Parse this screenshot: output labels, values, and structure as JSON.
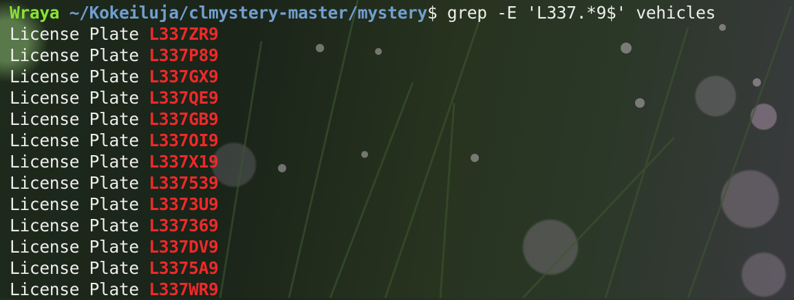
{
  "prompt": {
    "user": "Wraya",
    "path": "~/Kokeiluja/clmystery-master/mystery",
    "symbol": "$",
    "command": " grep -E 'L337.*9$' vehicles"
  },
  "output": [
    {
      "prefix": "License Plate ",
      "match": "L337ZR9"
    },
    {
      "prefix": "License Plate ",
      "match": "L337P89"
    },
    {
      "prefix": "License Plate ",
      "match": "L337GX9"
    },
    {
      "prefix": "License Plate ",
      "match": "L337QE9"
    },
    {
      "prefix": "License Plate ",
      "match": "L337GB9"
    },
    {
      "prefix": "License Plate ",
      "match": "L337OI9"
    },
    {
      "prefix": "License Plate ",
      "match": "L337X19"
    },
    {
      "prefix": "License Plate ",
      "match": "L337539"
    },
    {
      "prefix": "License Plate ",
      "match": "L3373U9"
    },
    {
      "prefix": "License Plate ",
      "match": "L337369"
    },
    {
      "prefix": "License Plate ",
      "match": "L337DV9"
    },
    {
      "prefix": "License Plate ",
      "match": "L3375A9"
    },
    {
      "prefix": "License Plate ",
      "match": "L337WR9"
    }
  ],
  "colors": {
    "user": "#8ae234",
    "path": "#729fcf",
    "match": "#ef2929",
    "text": "#eeeeec"
  }
}
